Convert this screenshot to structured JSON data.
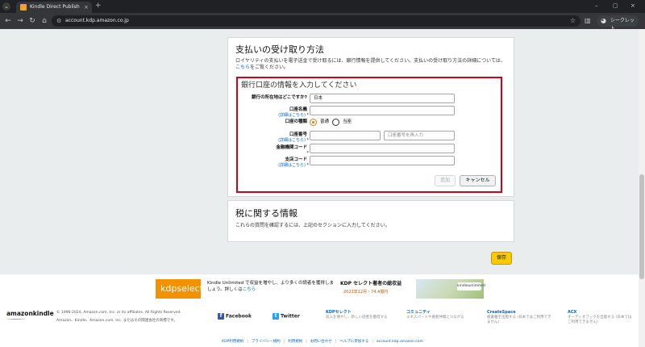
{
  "browser": {
    "tab_title": "Kindle Direct Publishing - 受取...",
    "tab_close": "×",
    "new_tab": "+",
    "url": "account.kdp.amazon.co.jp",
    "incognito_label": "シークレット",
    "window_controls": [
      "–",
      "▢",
      "×"
    ]
  },
  "payment": {
    "title": "支払いの受け取り方法",
    "description_pre": "ロイヤリティの支払いを電子送金で受け取るには、銀行情報を提供してください。支払いの受け取り方法の詳細については、",
    "description_link": "こちら",
    "description_post": "をご覧ください。",
    "bank_section": {
      "title": "銀行口座の情報を入力してください",
      "country_label": "銀行の所在地はどこですか?",
      "country_value": "日本",
      "account_name_label": "口座名義",
      "account_type_label": "口座の種類",
      "account_type_options": [
        "普通",
        "当座"
      ],
      "account_number_label": "口座番号",
      "account_number_confirm_placeholder": "口座番号を再入力",
      "bank_code_label": "金融機関コード",
      "branch_code_label": "支店コード",
      "help_link": "(詳細はこちら)",
      "required_mark": "*",
      "add_button": "追加",
      "cancel_button": "キャンセル"
    }
  },
  "tax": {
    "title": "税に関する情報",
    "description": "これらの質問を確認するには、上記のセクションに入力してください。"
  },
  "save_button": "保存",
  "footer": {
    "banner_logo": "kdpselect",
    "banner_text_pre": "Kindle Unlimited で収益を増やし、より多くの読者を獲得しましょう。詳しくは",
    "banner_text_link": "こちら",
    "banner_right_title": "KDP セレクト著者の総収益",
    "banner_right_sub": "2023年12月・74.4億円",
    "banner_image_badge": "kindleunlimited",
    "amazon_logo": "amazonkindle",
    "copyright_line1": "© 1996-2024, Amazon.com, Inc. or its affiliates. All Rights Reserved.",
    "copyright_line2": "Amazon、Kindle、Amazon.com, Inc. またはその関連会社の商標です。",
    "facebook": "Facebook",
    "twitter": "Twitter",
    "columns": [
      {
        "title": "KDPセレクト",
        "desc": "収入を増やし、新しい読者を獲得する"
      },
      {
        "title": "コミュニティ",
        "desc": "エキスパートや著者仲間とつながる"
      },
      {
        "title": "CreateSpace",
        "desc": "紙書籍を出版する (日本ではご利用できません)"
      },
      {
        "title": "ACX",
        "desc": "オーディオブックを出版する (日本ではご利用できません)"
      }
    ],
    "bottom_links": [
      "KDP利用規約",
      "プライバシー規約",
      "利用規約",
      "お問い合わせ",
      "ヘルプに参加する",
      "account.kdp.amazon.com"
    ]
  }
}
